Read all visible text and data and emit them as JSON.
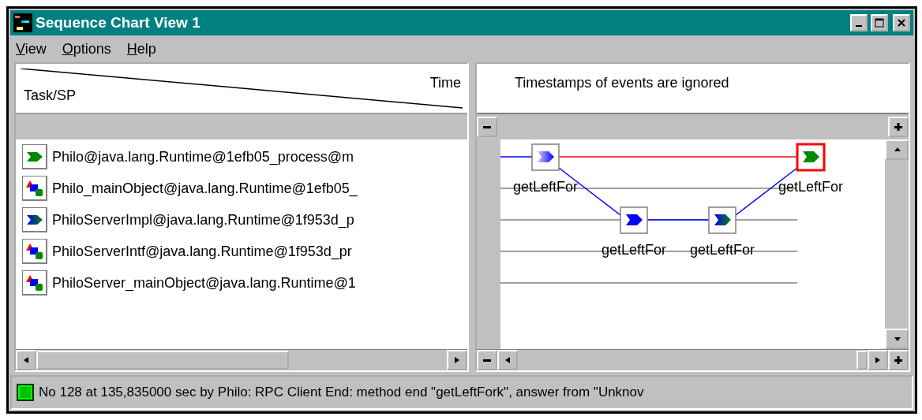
{
  "window": {
    "title": "Sequence Chart View 1"
  },
  "menu": [
    {
      "label": "View"
    },
    {
      "label": "Options"
    },
    {
      "label": "Help"
    }
  ],
  "task_panel": {
    "header_left": "Task/SP",
    "header_right": "Time",
    "rows": [
      {
        "kind": "process",
        "label": "Philo@java.lang.Runtime@1efb05_process@m"
      },
      {
        "kind": "object",
        "label": "Philo_mainObject@java.lang.Runtime@1efb05_"
      },
      {
        "kind": "impl",
        "label": "PhiloServerImpl@java.lang.Runtime@1f953d_p"
      },
      {
        "kind": "object",
        "label": "PhiloServerIntf@java.lang.Runtime@1f953d_pr"
      },
      {
        "kind": "object",
        "label": "PhiloServer_mainObject@java.lang.Runtime@1"
      }
    ]
  },
  "chart_panel": {
    "note": "Timestamps of events are ignored",
    "events": [
      {
        "kind": "start",
        "label": "getLeftFor",
        "selected": false
      },
      {
        "kind": "send",
        "label": "getLeftFor",
        "selected": false
      },
      {
        "kind": "mixed",
        "label": "getLeftFor",
        "selected": false
      },
      {
        "kind": "end",
        "label": "getLeftFor",
        "selected": true
      }
    ]
  },
  "status_bar": {
    "text": "No 128 at 135,835000 sec by Philo: RPC Client End: method end \"getLeftFork\", answer from \"Unknov"
  }
}
